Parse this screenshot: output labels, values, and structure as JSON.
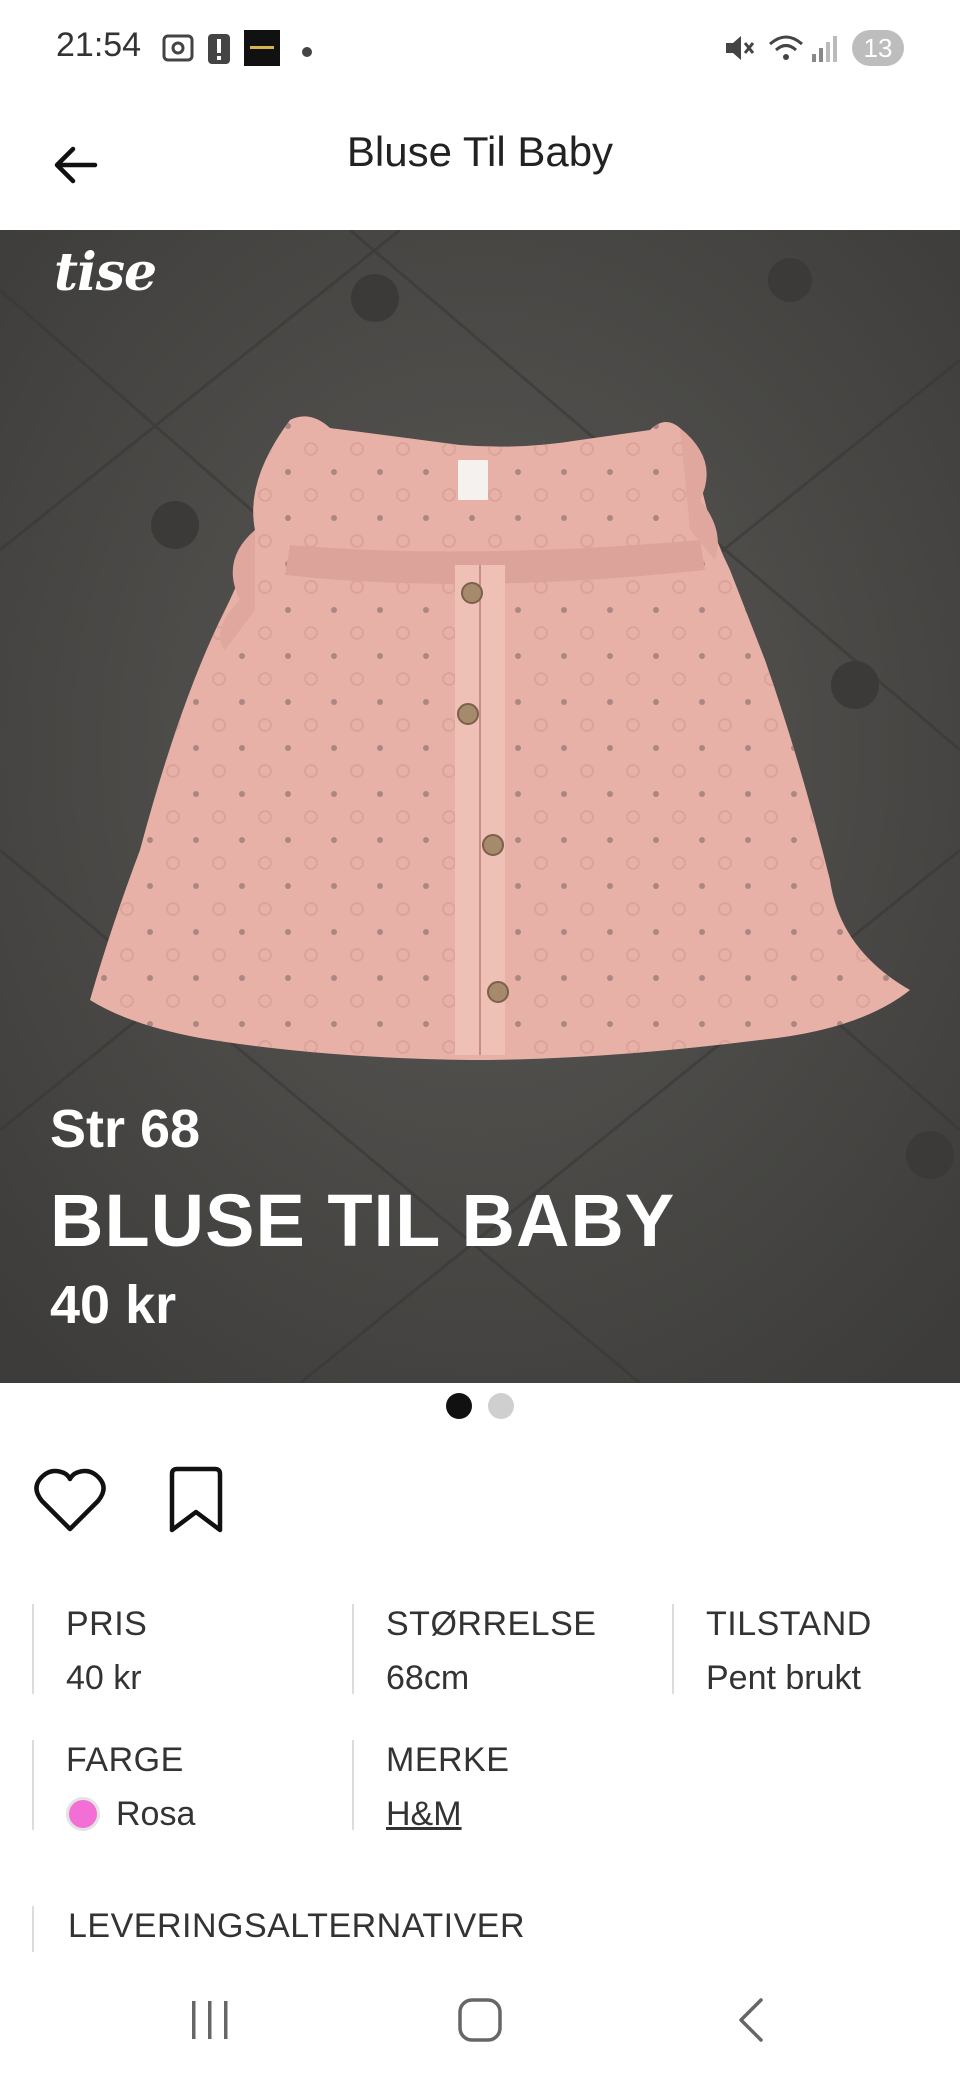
{
  "status_bar": {
    "time": "21:54",
    "badge_count": "13",
    "icons": [
      "screenshot-icon",
      "alert-icon",
      "app-thumbnail-icon",
      "notification-dot-icon",
      "mute-icon",
      "wifi-icon",
      "signal-icon"
    ]
  },
  "header": {
    "title": "Bluse Til Baby",
    "back_icon": "arrow-left-icon"
  },
  "hero": {
    "logo": "tise",
    "size_text": "Str 68",
    "name_text": "BLUSE TIL BABY",
    "price_text": "40 kr",
    "image_description_icon": "pink-baby-blouse-photo",
    "pager_count": 2,
    "pager_active": 0
  },
  "actions": {
    "like_icon": "heart-icon",
    "save_icon": "bookmark-icon"
  },
  "details": {
    "price": {
      "label": "PRIS",
      "value": "40 kr"
    },
    "size": {
      "label": "STØRRELSE",
      "value": "68cm"
    },
    "condition": {
      "label": "TILSTAND",
      "value": "Pent brukt"
    },
    "color": {
      "label": "FARGE",
      "value": "Rosa",
      "swatch": "#f36fd6"
    },
    "brand": {
      "label": "MERKE",
      "value": "H&M"
    }
  },
  "delivery": {
    "label": "LEVERINGSALTERNATIVER"
  },
  "nav_bar": {
    "icons": [
      "recent-apps-icon",
      "home-icon",
      "back-icon"
    ]
  },
  "colors": {
    "background": "#ffffff",
    "hero_bg": "#4a4947",
    "garment": "#eab5ab",
    "text": "#222222"
  }
}
